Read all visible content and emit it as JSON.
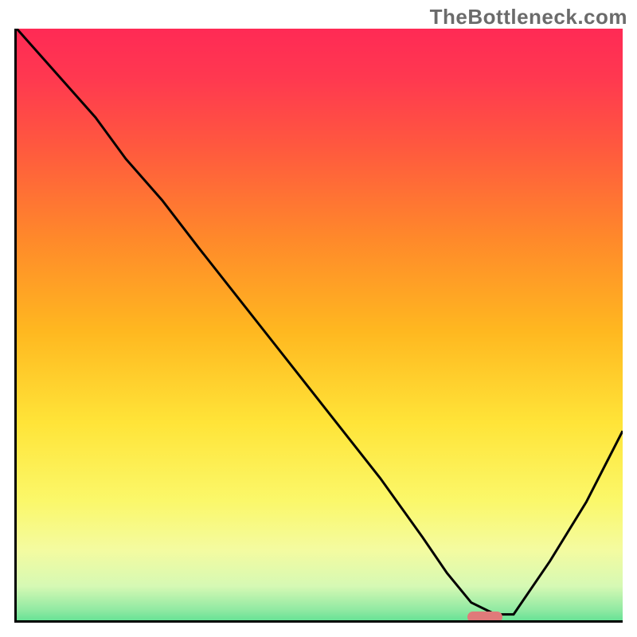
{
  "watermark": "TheBottleneck.com",
  "chart_data": {
    "type": "line",
    "title": "",
    "xlabel": "",
    "ylabel": "",
    "xlim": [
      0,
      100
    ],
    "ylim": [
      0,
      100
    ],
    "grid": false,
    "legend": false,
    "background_gradient_stops": [
      {
        "offset": 0.0,
        "color": "#ff2a55"
      },
      {
        "offset": 0.08,
        "color": "#ff3850"
      },
      {
        "offset": 0.2,
        "color": "#ff5a3e"
      },
      {
        "offset": 0.35,
        "color": "#ff8a2a"
      },
      {
        "offset": 0.5,
        "color": "#ffb820"
      },
      {
        "offset": 0.65,
        "color": "#ffe438"
      },
      {
        "offset": 0.78,
        "color": "#fbf86a"
      },
      {
        "offset": 0.86,
        "color": "#f4fba0"
      },
      {
        "offset": 0.92,
        "color": "#d6f9b4"
      },
      {
        "offset": 0.96,
        "color": "#8fe9a2"
      },
      {
        "offset": 1.0,
        "color": "#2fd884"
      }
    ],
    "series": [
      {
        "name": "bottleneck-curve",
        "color": "#000000",
        "x": [
          0,
          13,
          18,
          24,
          30,
          40,
          50,
          60,
          67,
          71,
          75,
          79,
          82,
          88,
          94,
          100
        ],
        "y": [
          100,
          85,
          78,
          71,
          63,
          50,
          37,
          24,
          14,
          8,
          3,
          1,
          1,
          10,
          20,
          32
        ]
      }
    ],
    "marker": {
      "name": "optimal-range",
      "x_center": 77,
      "y": 1,
      "color": "#e07a7a"
    }
  }
}
